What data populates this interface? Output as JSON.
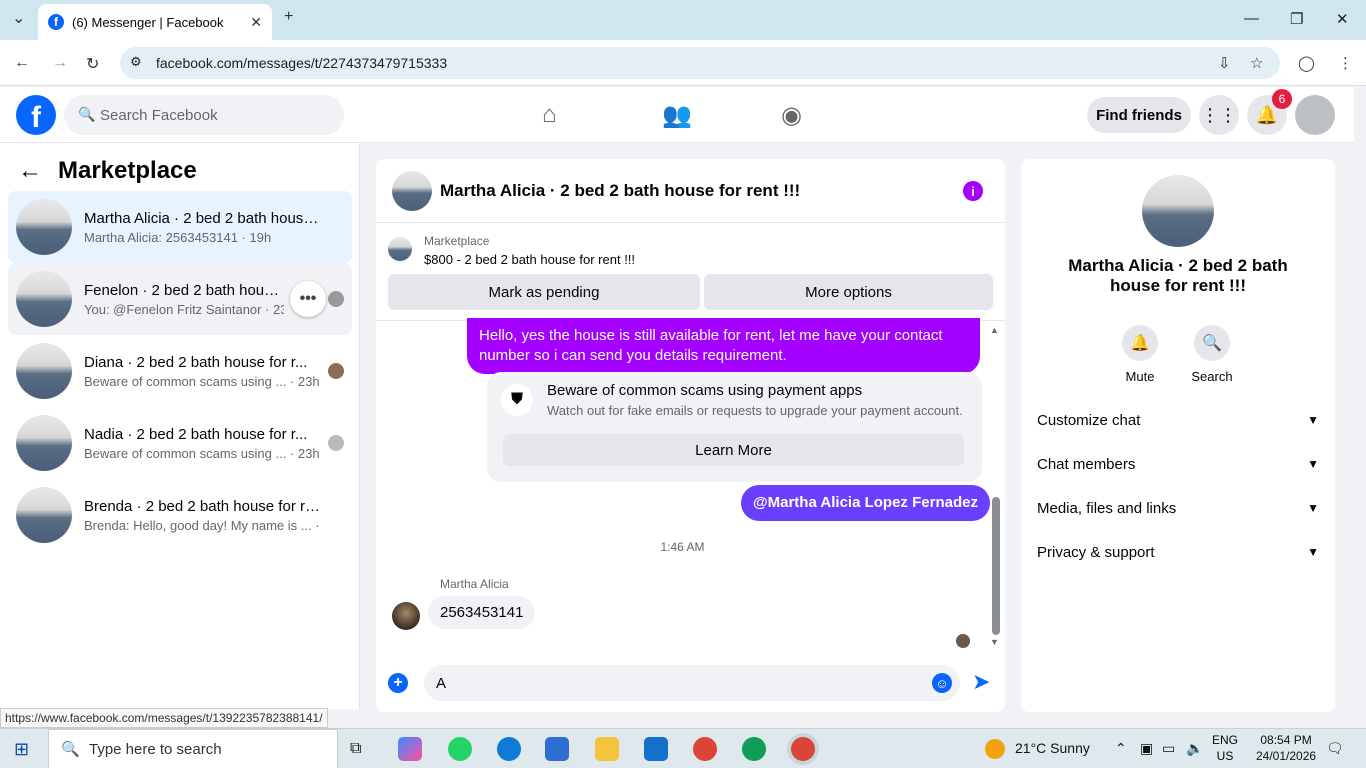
{
  "browser": {
    "tab_title": "(6) Messenger | Facebook",
    "url": "facebook.com/messages/t/2274373479715333",
    "status_url": "https://www.facebook.com/messages/t/1392235782388141/"
  },
  "header": {
    "search_placeholder": "Search Facebook",
    "find_friends": "Find friends",
    "notifications_count": "6"
  },
  "left": {
    "title": "Marketplace",
    "conversations": [
      {
        "name": "Martha Alicia · 2 bed 2 bath house...",
        "preview": "Martha Alicia: 2563453141 · 19h"
      },
      {
        "name": "Fenelon · 2 bed 2 bath house f...",
        "preview": "You: @Fenelon Fritz Saintanor · 23h"
      },
      {
        "name": "Diana · 2 bed 2 bath house for r...",
        "preview": "Beware of common scams using ...  · 23h"
      },
      {
        "name": "Nadia · 2 bed 2 bath house for r...",
        "preview": "Beware of common scams using ...  · 23h"
      },
      {
        "name": "Brenda · 2 bed 2 bath house for re...",
        "preview": "Brenda: Hello, good day! My name is ... · 1w"
      }
    ]
  },
  "chat": {
    "title": "Martha Alicia · 2 bed 2 bath house for rent !!!",
    "marketplace_label": "Marketplace",
    "listing": "$800 - 2 bed 2 bath house for rent !!!",
    "mark_pending": "Mark as pending",
    "more_options": "More options",
    "outgoing_1": "Hello, yes the house is still available for rent, let me have your contact number so i can send you details requirement.",
    "scam_title": "Beware of common scams using payment apps",
    "scam_sub": "Watch out for fake emails or requests to upgrade your payment account.",
    "learn_more": "Learn More",
    "outgoing_2": "@Martha Alicia Lopez Fernadez",
    "time": "1:46 AM",
    "sender": "Martha Alicia",
    "incoming": "2563453141",
    "composer_value": "A"
  },
  "right": {
    "name": "Martha Alicia · 2 bed 2 bath house for rent !!!",
    "mute": "Mute",
    "search": "Search",
    "sections": [
      "Customize chat",
      "Chat members",
      "Media, files and links",
      "Privacy & support"
    ]
  },
  "taskbar": {
    "search_placeholder": "Type here to search",
    "weather": "21°C  Sunny",
    "lang_1": "ENG",
    "lang_2": "US",
    "time": "08:54 PM",
    "date": "24/01/2026"
  }
}
